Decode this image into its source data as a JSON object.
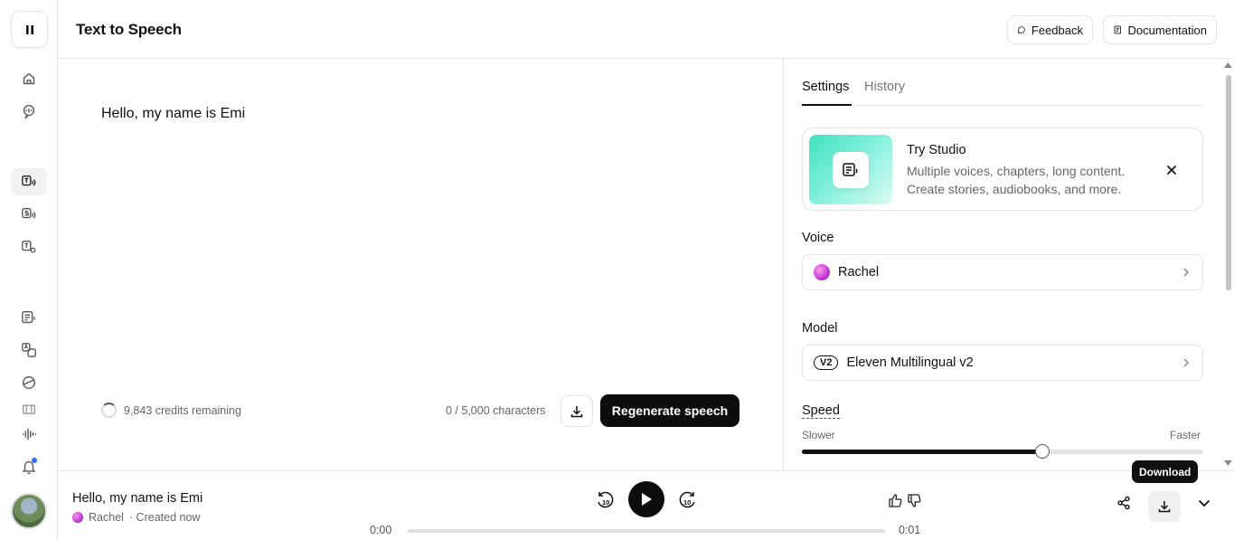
{
  "header": {
    "title": "Text to Speech",
    "feedback_label": "Feedback",
    "documentation_label": "Documentation"
  },
  "editor": {
    "text": "Hello, my name is Emi",
    "credits": "9,843 credits remaining",
    "char_count": "0 / 5,000 characters",
    "regenerate_label": "Regenerate speech"
  },
  "panel": {
    "tabs": [
      {
        "label": "Settings",
        "active": true
      },
      {
        "label": "History",
        "active": false
      }
    ],
    "studio": {
      "title": "Try Studio",
      "description": "Multiple voices, chapters, long content. Create stories, audiobooks, and more."
    },
    "voice_label": "Voice",
    "voice_value": "Rachel",
    "model_label": "Model",
    "model_badge": "V2",
    "model_value": "Eleven Multilingual v2",
    "speed_label": "Speed",
    "speed_min_label": "Slower",
    "speed_max_label": "Faster",
    "speed_value": 0.6
  },
  "player": {
    "title": "Hello, my name is Emi",
    "voice": "Rachel",
    "created": "· Created now",
    "time_current": "0:00",
    "time_total": "0:01",
    "progress": 0,
    "skip_back_label": "10",
    "skip_forward_label": "10",
    "download_tooltip": "Download"
  },
  "sidebar": {
    "items": [
      {
        "icon": "home-icon"
      },
      {
        "icon": "voice-chat-icon"
      },
      {
        "icon": "text-to-speech-icon",
        "active": true
      },
      {
        "icon": "speech-to-speech-icon"
      },
      {
        "icon": "voice-settings-icon"
      },
      {
        "icon": "studio-icon"
      },
      {
        "icon": "dubbing-icon"
      },
      {
        "icon": "voice-library-icon"
      },
      {
        "icon": "sound-effects-icon"
      },
      {
        "icon": "audio-wave-icon"
      },
      {
        "icon": "bell-icon"
      }
    ]
  },
  "colors": {
    "accent": "#0d0d0d",
    "border": "#e3e3e3",
    "studio_gradient_start": "#3fe0c2",
    "notification": "#2f6bff"
  }
}
